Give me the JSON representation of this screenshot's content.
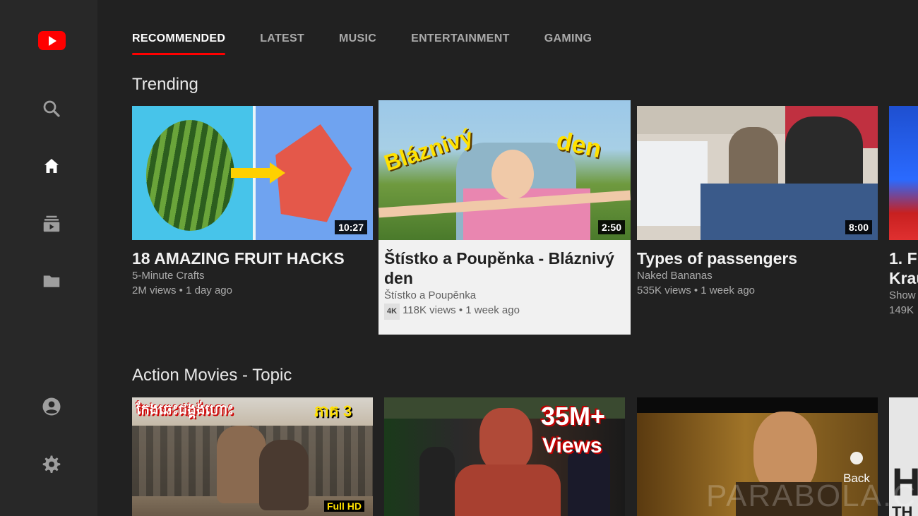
{
  "tabs": [
    "RECOMMENDED",
    "LATEST",
    "MUSIC",
    "ENTERTAINMENT",
    "GAMING"
  ],
  "shelves": [
    {
      "title": "Trending",
      "cards": [
        {
          "title": "18 AMAZING FRUIT HACKS",
          "channel": "5-Minute Crafts",
          "stats": "2M views • 1 day ago",
          "duration": "10:27"
        },
        {
          "title": "Štístko a Poupěnka - Bláznivý den",
          "channel": "Štístko a Poupěnka",
          "badge": "4K",
          "stats": "118K views • 1 week ago",
          "duration": "2:50",
          "thumb_text": [
            "Bláznivý",
            "den"
          ]
        },
        {
          "title": "Types of passengers",
          "channel": "Naked Bananas",
          "stats": "535K views • 1 week ago",
          "duration": "8:00"
        },
        {
          "title": "1. F",
          "title_line2": "Krau",
          "channel": "Show",
          "stats": "149K"
        }
      ]
    },
    {
      "title": "Action Movies - Topic",
      "cards": [
        {
          "thumb_text": [
            "កែងឆេះជង្គង់ហោះ",
            "ភាគ 3",
            "Full HD"
          ]
        },
        {
          "thumb_text": [
            "35M+",
            "Views"
          ]
        },
        {},
        {
          "thumb_text": [
            "H",
            "TH"
          ]
        }
      ]
    }
  ],
  "overlay": {
    "back_label": "Back",
    "watermark": "PARABOLA.CZ"
  },
  "icons": {
    "logo": "youtube-logo-icon",
    "search": "search-icon",
    "home": "home-icon",
    "subscriptions": "subscriptions-icon",
    "library": "folder-icon",
    "account": "account-icon",
    "settings": "gear-icon"
  },
  "colors": {
    "accent": "#ff0000",
    "background": "#212121",
    "sidebar": "#282828",
    "focus_card": "#f1f1f1"
  }
}
